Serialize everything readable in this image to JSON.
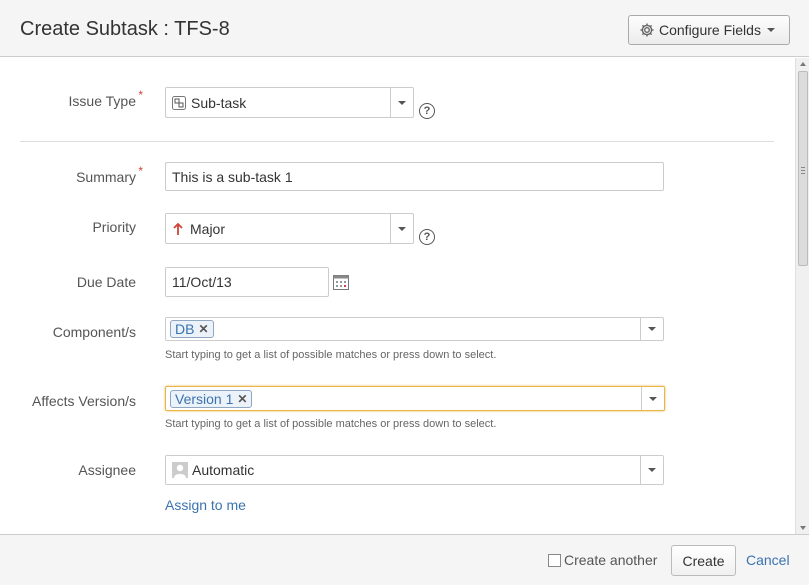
{
  "dialog": {
    "title": "Create Subtask : TFS-8",
    "configure_fields_label": "Configure Fields"
  },
  "form": {
    "issue_type": {
      "label": "Issue Type",
      "required_mark": "*",
      "value": "Sub-task",
      "icon": "subtask-icon"
    },
    "summary": {
      "label": "Summary",
      "required_mark": "*",
      "value": "This is a sub-task 1"
    },
    "priority": {
      "label": "Priority",
      "value": "Major",
      "icon": "up-arrow-icon",
      "icon_color": "#d04437"
    },
    "due_date": {
      "label": "Due Date",
      "value": "11/Oct/13",
      "icon": "calendar-icon"
    },
    "components": {
      "label": "Component/s",
      "tags": [
        "DB"
      ],
      "hint": "Start typing to get a list of possible matches or press down to select."
    },
    "affects_versions": {
      "label": "Affects Version/s",
      "tags": [
        "Version 1"
      ],
      "hint": "Start typing to get a list of possible matches or press down to select.",
      "focus_color": "#e8b64a"
    },
    "assignee": {
      "label": "Assignee",
      "value": "Automatic",
      "icon": "user-avatar-icon",
      "assign_to_me": "Assign to me"
    }
  },
  "footer": {
    "create_another_label": "Create another",
    "create_another_checked": false,
    "create_label": "Create",
    "cancel_label": "Cancel"
  },
  "colors": {
    "link": "#3b73af",
    "required": "#d04437",
    "header_bg": "#f5f5f5"
  }
}
